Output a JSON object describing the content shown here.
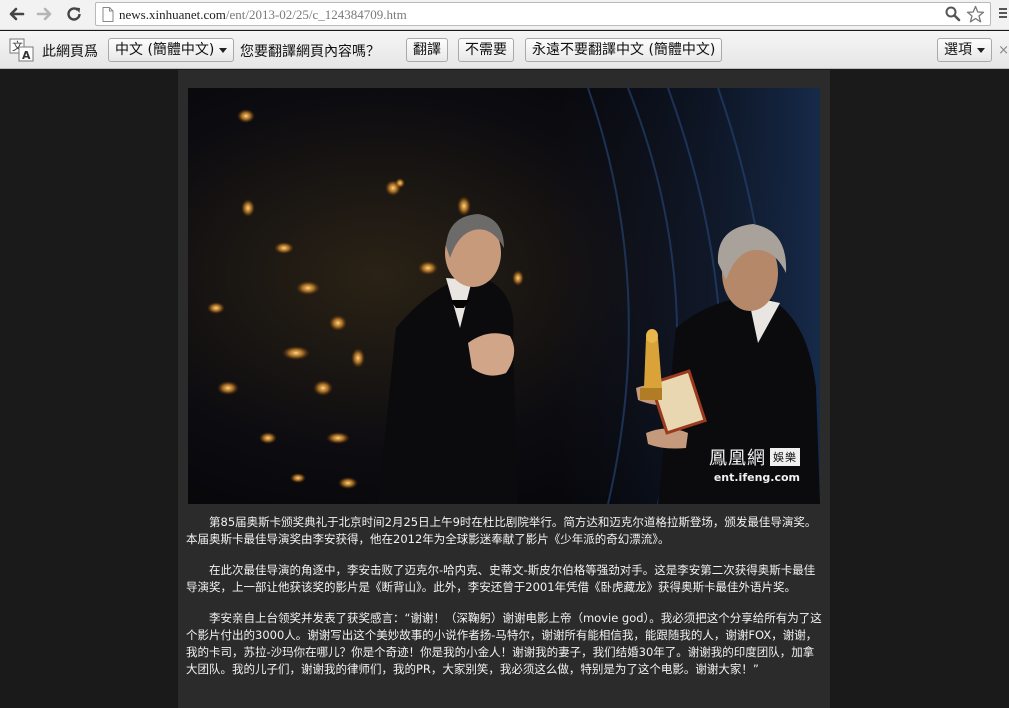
{
  "browser": {
    "url_host": "news.xinhuanet.com",
    "url_path": "/ent/2013-02/25/c_124384709.htm"
  },
  "translate_bar": {
    "prefix": "此網頁爲",
    "language": "中文 (簡體中文)",
    "question": "您要翻譯網頁內容嗎？",
    "translate_button": "翻譯",
    "no_button": "不需要",
    "never_button": "永遠不要翻譯中文 (簡體中文)",
    "options_button": "選項",
    "close_glyph": "×"
  },
  "photo": {
    "watermark_cn": "鳳凰網",
    "watermark_badge": "娛樂",
    "watermark_url": "ent.ifeng.com"
  },
  "article": {
    "paragraphs": [
      "第85届奥斯卡颁奖典礼于北京时间2月25日上午9时在杜比剧院举行。简方达和迈克尔道格拉斯登场，颁发最佳导演奖。本届奥斯卡最佳导演奖由李安获得，他在2012年为全球影迷奉献了影片《少年派的奇幻漂流》。",
      "在此次最佳导演的角逐中，李安击败了迈克尔-哈内克、史蒂文-斯皮尔伯格等强劲对手。这是李安第二次获得奥斯卡最佳导演奖，上一部让他获该奖的影片是《断背山》。此外，李安还曾于2001年凭借《卧虎藏龙》获得奥斯卡最佳外语片奖。",
      "李安亲自上台领奖并发表了获奖感言：“谢谢！（深鞠躬）谢谢电影上帝（movie god）。我必须把这个分享给所有为了这个影片付出的3000人。谢谢写出这个美妙故事的小说作者扬-马特尔，谢谢所有能相信我，能跟随我的人，谢谢FOX，谢谢，我的卡司，苏拉-沙玛你在哪儿？你是个奇迹！你是我的小金人！谢谢我的妻子，我们结婚30年了。谢谢我的印度团队，加拿大团队。我的儿子们，谢谢我的律师们，我的PR，大家别笑，我必须这么做，特别是为了这个电影。谢谢大家！”"
    ]
  },
  "colors": {
    "page_bg": "#1a1a1a",
    "column_bg": "#2b2b2b",
    "article_text": "#f2f2f2"
  }
}
